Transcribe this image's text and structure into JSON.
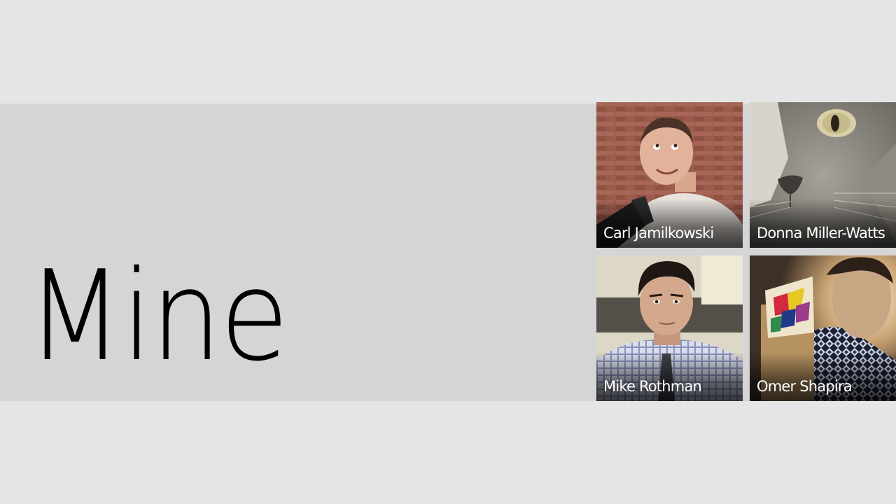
{
  "section": {
    "title": "Mine"
  },
  "people": [
    {
      "name": "Carl Jamilkowski"
    },
    {
      "name": "Donna Miller-Watts"
    },
    {
      "name": "Mike Rothman"
    },
    {
      "name": "Omer Shapira"
    }
  ],
  "colors": {
    "background": "#e5e5e5",
    "band": "#d5d5d5",
    "title_text": "#000000",
    "tile_text": "#ffffff"
  }
}
